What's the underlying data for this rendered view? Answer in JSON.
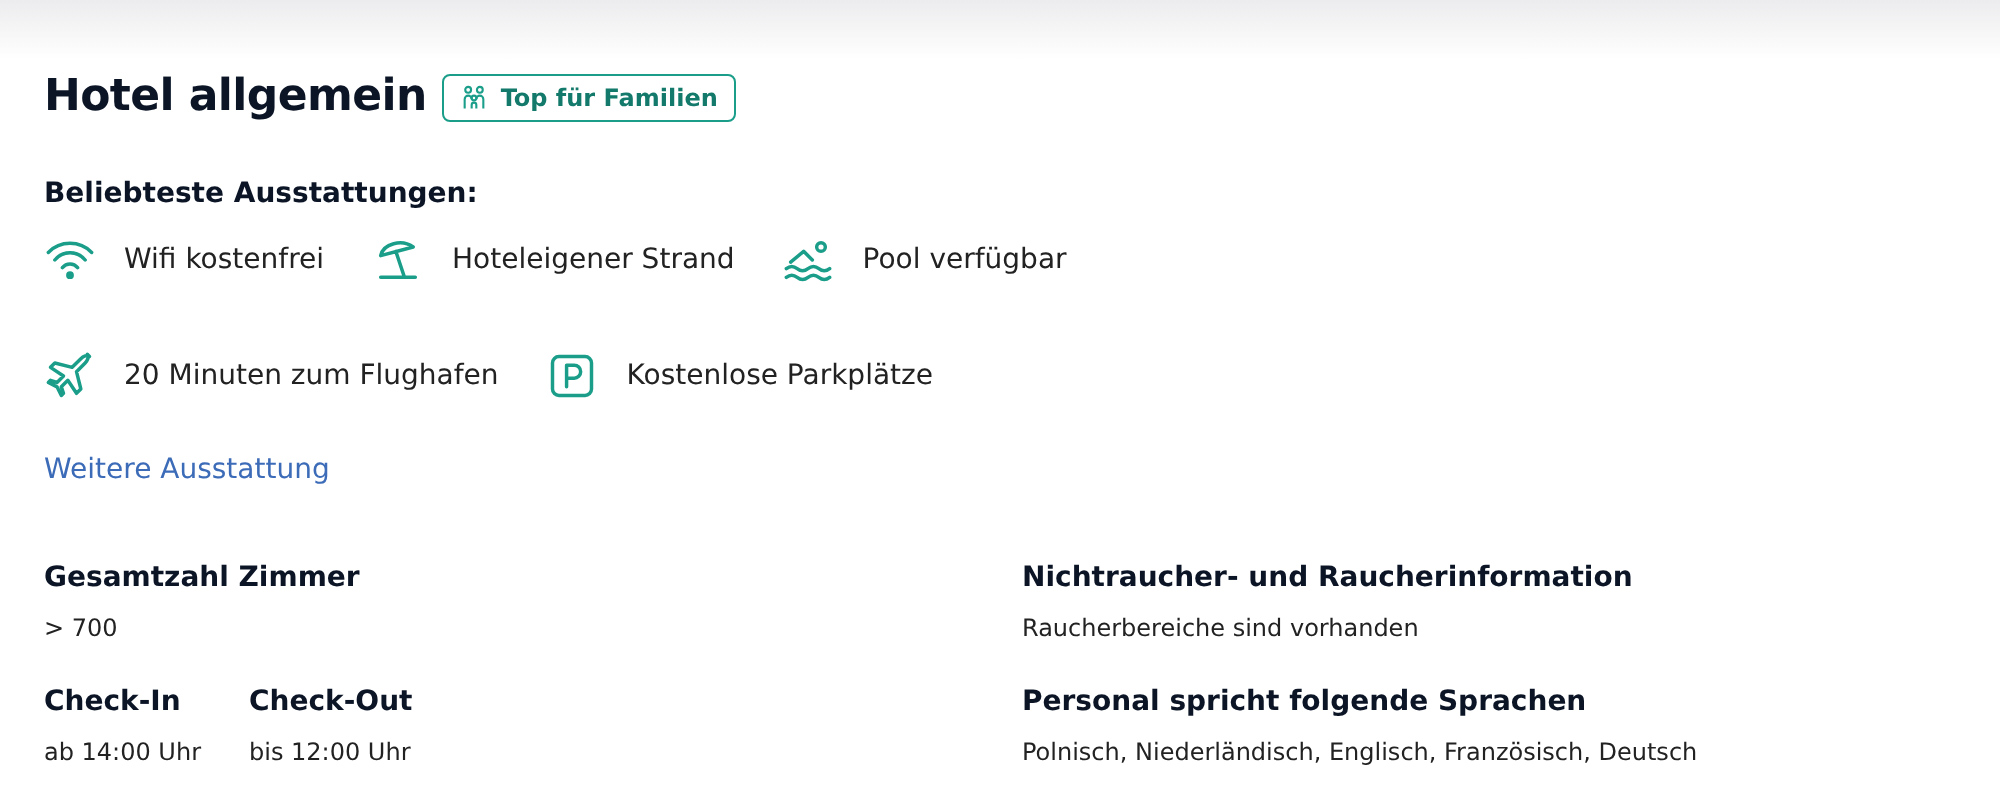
{
  "title": "Hotel allgemein",
  "badge": {
    "label": "Top für Familien"
  },
  "amenities_heading": "Beliebteste Ausstattungen:",
  "amenities": [
    {
      "kind": "wifi",
      "label": "Wifi kostenfrei"
    },
    {
      "kind": "beach",
      "label": "Hoteleigener Strand"
    },
    {
      "kind": "pool",
      "label": "Pool verfügbar"
    },
    {
      "kind": "plane",
      "label": "20 Minuten zum Flughafen"
    },
    {
      "kind": "parking",
      "label": "Kostenlose Parkplätze"
    }
  ],
  "more_link": "Weitere Ausstattung",
  "left_info": [
    [
      {
        "heading": "Gesamtzahl Zimmer",
        "value": "> 700"
      }
    ],
    [
      {
        "heading": "Check-In",
        "value": "ab 14:00 Uhr"
      },
      {
        "heading": "Check-Out",
        "value": "bis 12:00 Uhr"
      }
    ]
  ],
  "right_info": [
    {
      "heading": "Nichtraucher- und Raucherinformation",
      "value": "Raucherbereiche sind vorhanden"
    },
    {
      "heading": "Personal spricht folgende Sprachen",
      "value": "Polnisch, Niederländisch, Englisch, Französisch, Deutsch"
    }
  ]
}
